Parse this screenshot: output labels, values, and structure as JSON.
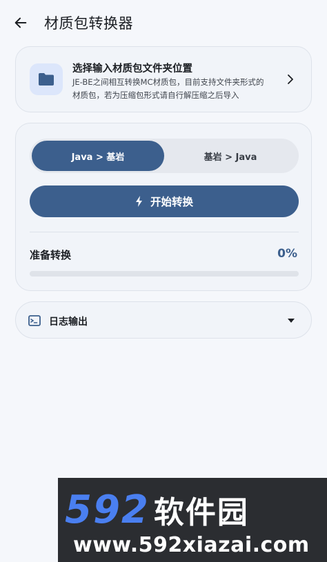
{
  "appbar": {
    "title": "材质包转换器"
  },
  "folder_card": {
    "title": "选择输入材质包文件夹位置",
    "desc_line1": "JE-BE之间相互转换MC材质包，目前支持文件夹形式的",
    "desc_line2": "材质包，若为压缩包形式请自行解压缩之后导入"
  },
  "convert_card": {
    "modes": [
      "Java > 基岩",
      "基岩 > Java"
    ],
    "selected_mode": 0,
    "start_label": "开始转换",
    "status_label": "准备转换",
    "progress_text": "0%",
    "progress": 0
  },
  "log_card": {
    "label": "日志输出"
  },
  "watermark": {
    "brand_num": "592",
    "brand_cn": "软件园",
    "url": "www.592xiazai.com"
  },
  "colors": {
    "accent": "#3c5f8d",
    "background": "#f5f7fb",
    "card": "#f1f4f9",
    "folder_bg": "#dce6fb"
  }
}
